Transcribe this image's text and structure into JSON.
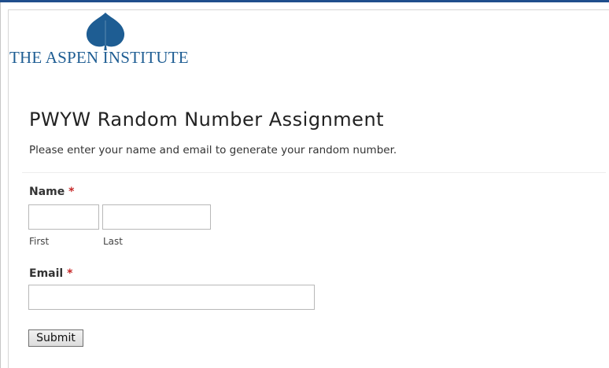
{
  "brand": {
    "logo_text": "THE ASPEN INSTITUTE",
    "color": "#1e5d93"
  },
  "form": {
    "title": "PWYW Random Number Assignment",
    "description": "Please enter your name and email to generate your random number.",
    "name": {
      "label": "Name",
      "required_marker": "*",
      "first_value": "",
      "last_value": "",
      "first_sublabel": "First",
      "last_sublabel": "Last"
    },
    "email": {
      "label": "Email",
      "required_marker": "*",
      "value": ""
    },
    "submit_label": "Submit"
  },
  "colors": {
    "accent_bar": "#1f4e8c",
    "required": "#c62828"
  }
}
